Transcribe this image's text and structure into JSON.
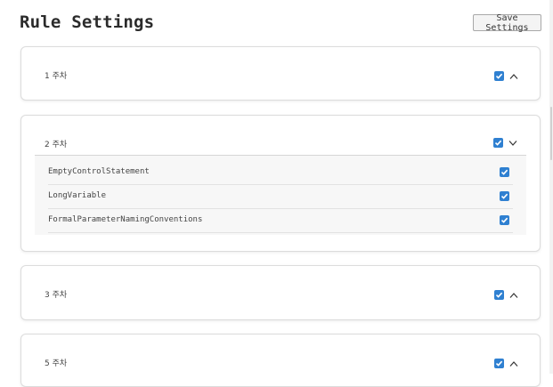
{
  "header": {
    "title": "Rule Settings",
    "save_label": "Save Settings"
  },
  "accent_color": "#2f80d1",
  "weeks": [
    {
      "label": "1 주차",
      "checked": true,
      "expanded": false
    },
    {
      "label": "2 주차",
      "checked": true,
      "expanded": true,
      "rules": [
        {
          "name": "EmptyControlStatement",
          "checked": true
        },
        {
          "name": "LongVariable",
          "checked": true
        },
        {
          "name": "FormalParameterNamingConventions",
          "checked": true
        }
      ]
    },
    {
      "label": "3 주차",
      "checked": true,
      "expanded": false
    },
    {
      "label": "5 주차",
      "checked": true,
      "expanded": false
    }
  ]
}
